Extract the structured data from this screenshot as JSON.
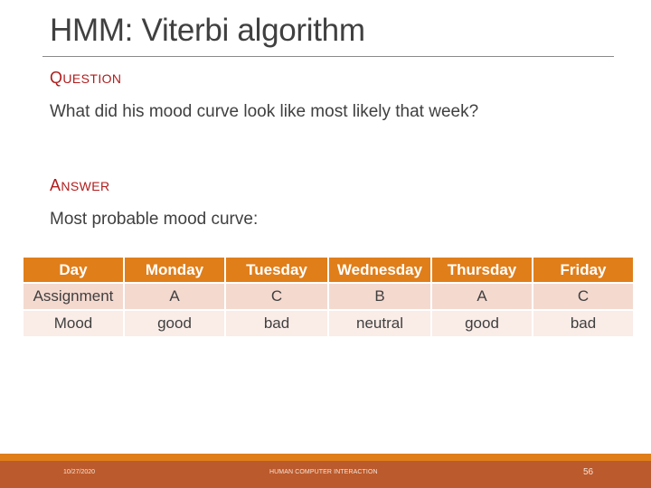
{
  "slide": {
    "title": "HMM: Viterbi algorithm",
    "question": {
      "heading_first": "Q",
      "heading_rest": "uestion",
      "text": "What did his mood curve look like most likely that week?"
    },
    "answer": {
      "heading_first": "A",
      "heading_rest": "nswer",
      "text": "Most probable mood curve:"
    },
    "table": {
      "header": [
        "Day",
        "Monday",
        "Tuesday",
        "Wednesday",
        "Thursday",
        "Friday"
      ],
      "rows": [
        [
          "Assignment",
          "A",
          "C",
          "B",
          "A",
          "C"
        ],
        [
          "Mood",
          "good",
          "bad",
          "neutral",
          "good",
          "bad"
        ]
      ]
    },
    "footer": {
      "date": "10/27/2020",
      "course": "HUMAN COMPUTER INTERACTION",
      "page_number": "56"
    },
    "colors": {
      "accent_orange": "#e07e1a",
      "footer_brown": "#bb5a2c",
      "heading_red": "#b01c1c",
      "row_light_1": "#f4d9cf",
      "row_light_2": "#faece7"
    }
  }
}
